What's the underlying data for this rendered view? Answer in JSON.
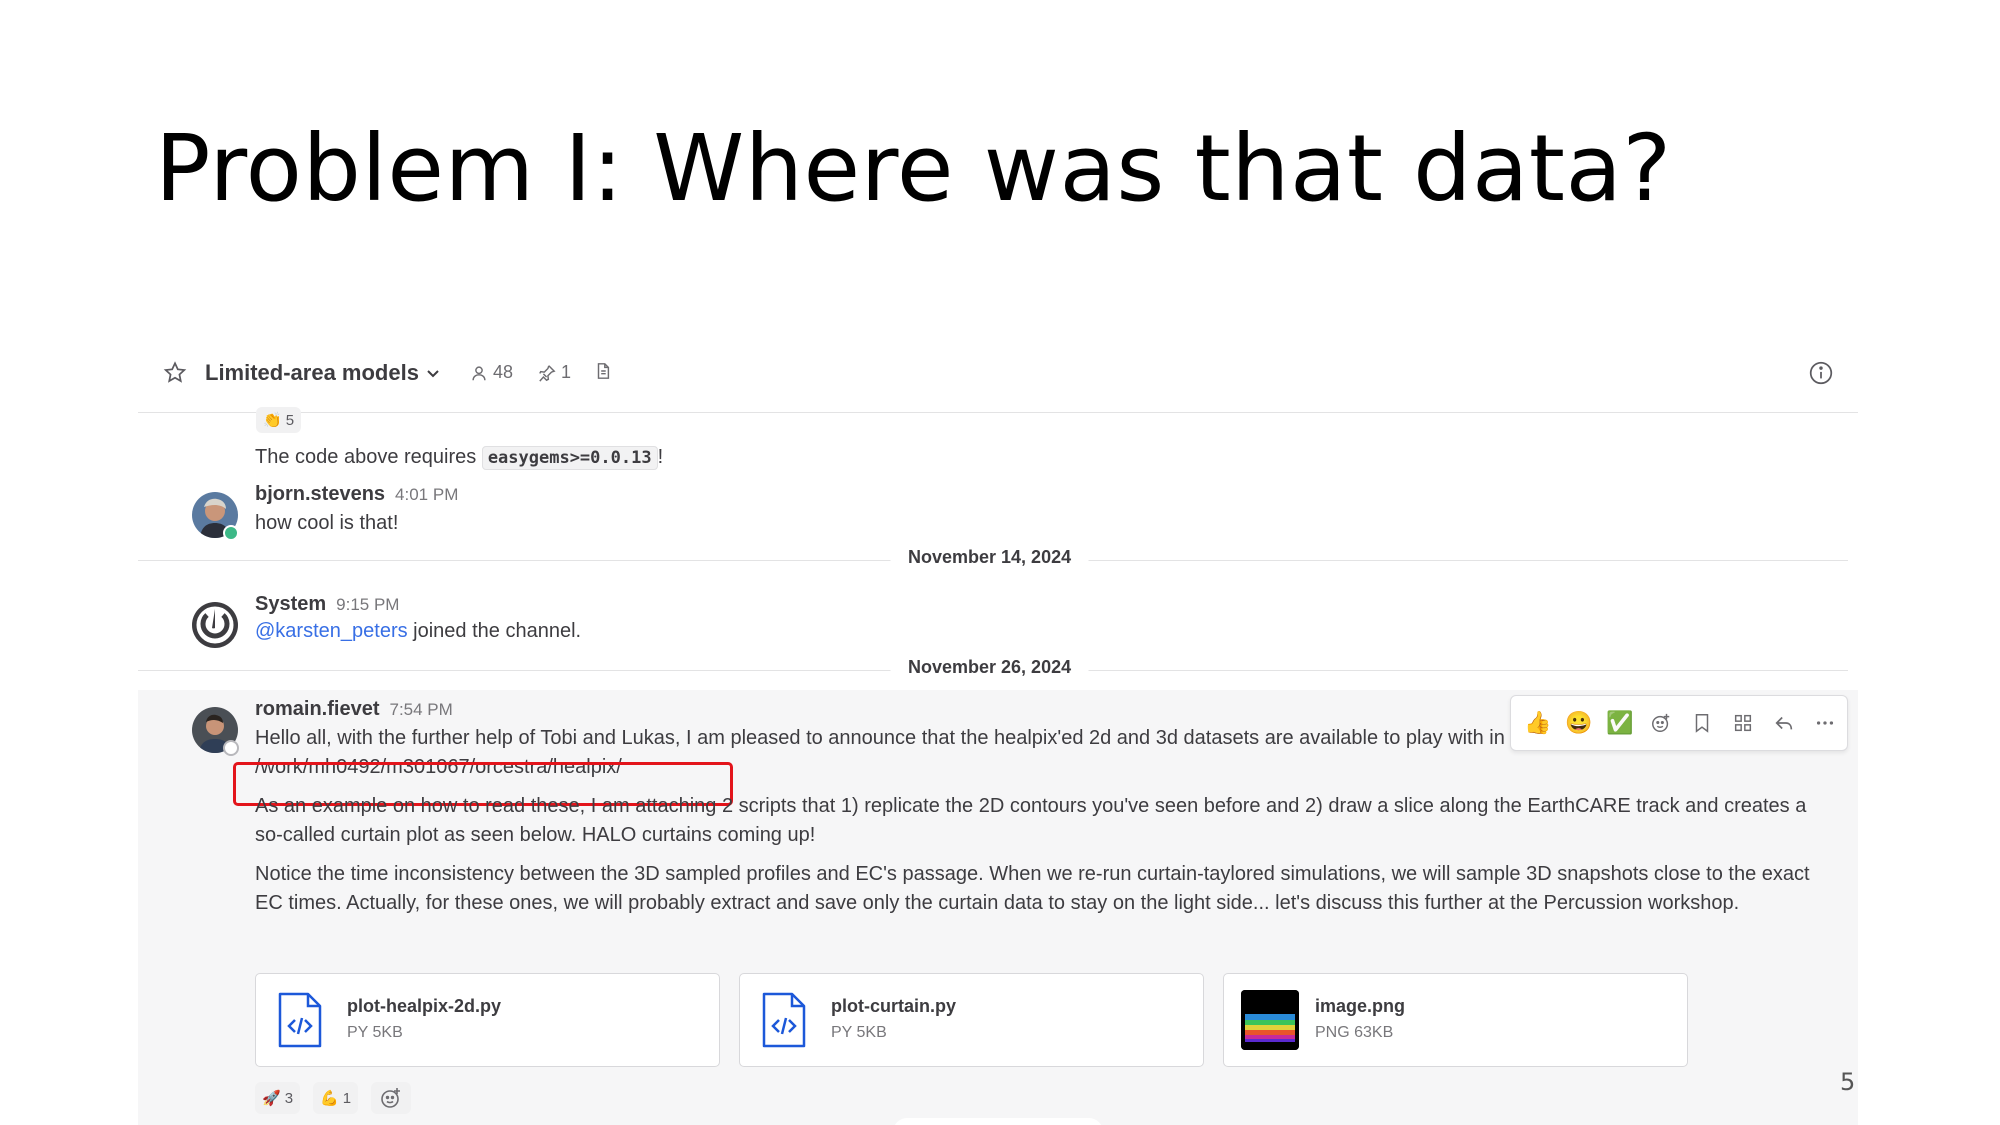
{
  "slide": {
    "title": "Problem I: Where was that data?",
    "page_number": "5"
  },
  "channel": {
    "name": "Limited-area models",
    "members": "48",
    "pinned": "1"
  },
  "messages": {
    "prev_reaction": {
      "emoji": "👏",
      "count": "5"
    },
    "code_note": {
      "before": "The code above requires ",
      "code": "easygems>=0.0.13",
      "after": "!"
    },
    "bjorn": {
      "username": "bjorn.stevens",
      "time": "4:01 PM",
      "text": "how cool is that!"
    },
    "date1": "November 14, 2024",
    "system": {
      "username": "System",
      "time": "9:15 PM",
      "mention": "@karsten_peters",
      "text": " joined the channel."
    },
    "date2": "November 26, 2024",
    "romain": {
      "username": "romain.fievet",
      "time": "7:54 PM",
      "line1": "Hello all, with the further help of Tobi and Lukas, I am pleased to announce that the healpix'ed 2d and 3d datasets are available to play with in",
      "path": "/work/mh0492/m301067/orcestra/healpix/",
      "para2": "As an example on how to read these, I am attaching 2 scripts that 1) replicate the 2D contours you've seen before and 2) draw a slice along the EarthCARE track and creates a so-called curtain plot as seen below. HALO curtains coming up!",
      "para3": "Notice the time inconsistency between the 3D sampled profiles and EC's passage. When we re-run curtain-taylored simulations, we will sample 3D snapshots close to the exact EC times. Actually, for these ones, we will probably extract and save only the curtain data to stay on the light side... let's discuss this further at the Percussion workshop."
    }
  },
  "toolbar": {
    "emojis": [
      "👍",
      "😀",
      "✅"
    ]
  },
  "files": [
    {
      "name": "plot-healpix-2d.py",
      "meta": "PY 5KB"
    },
    {
      "name": "plot-curtain.py",
      "meta": "PY 5KB"
    },
    {
      "name": "image.png",
      "meta": "PNG 63KB"
    }
  ],
  "reactions": [
    {
      "emoji": "🚀",
      "count": "3"
    },
    {
      "emoji": "💪",
      "count": "1"
    }
  ],
  "colors": {
    "mention": "#386fe5",
    "highlight": "#e3141b",
    "file_icon": "#1c58d9",
    "online": "#3db887"
  }
}
